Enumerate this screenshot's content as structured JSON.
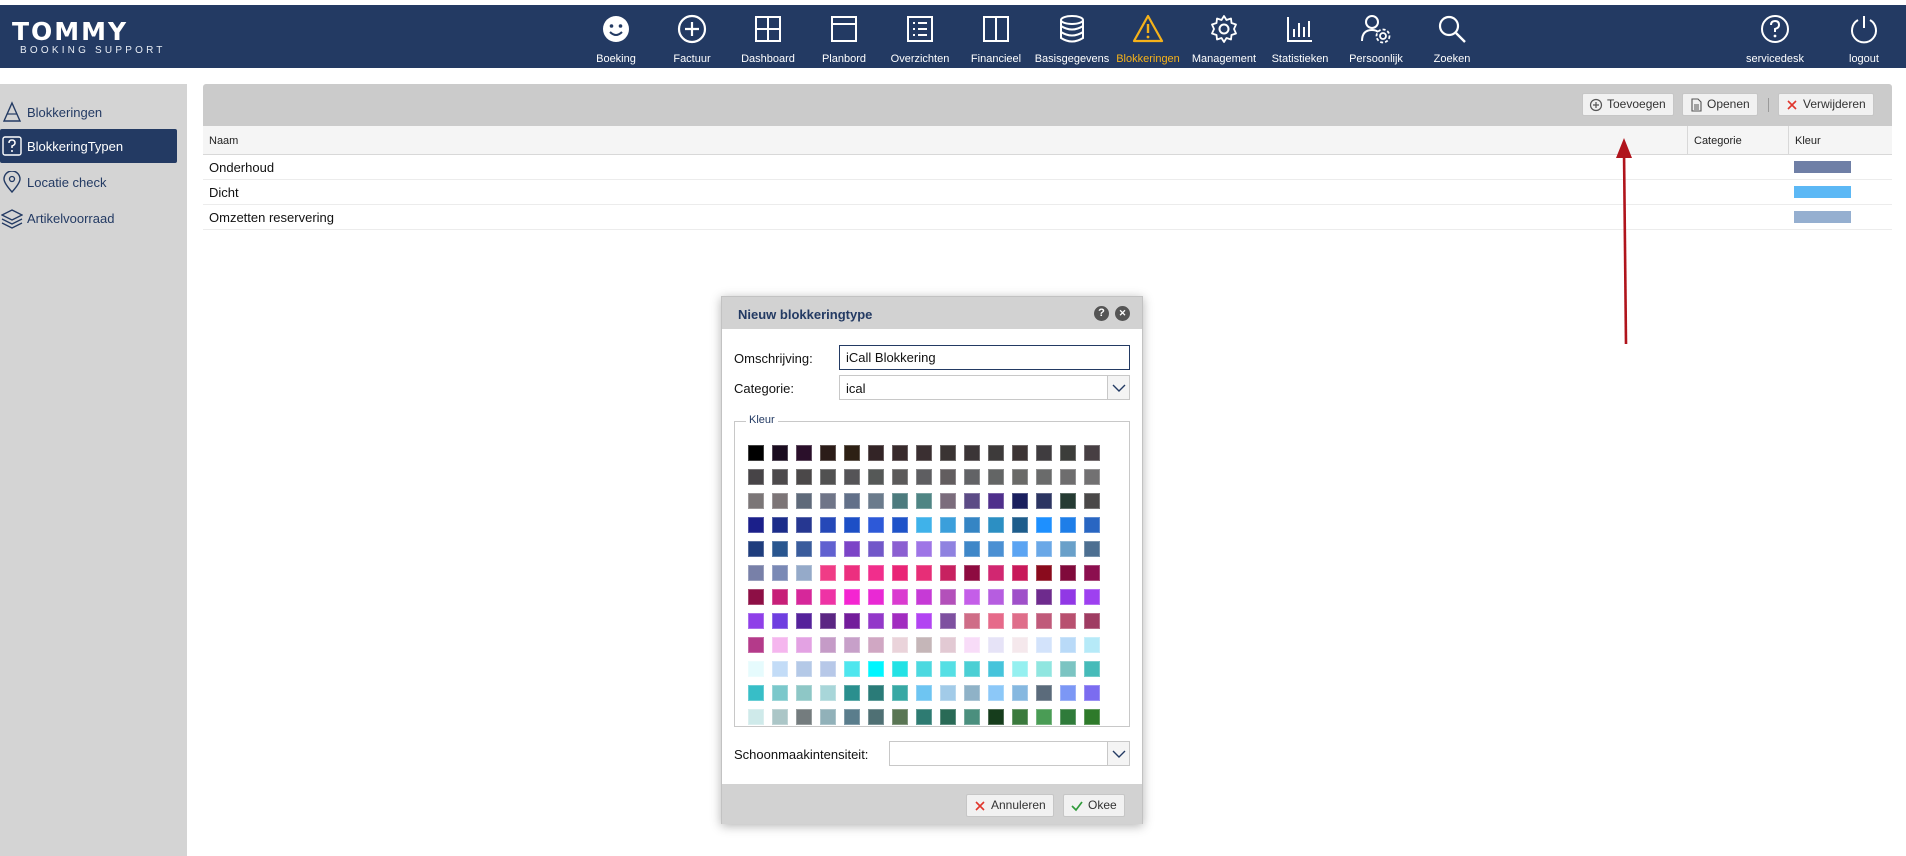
{
  "app": {
    "logo_text": "TOMMY",
    "logo_subtext": "BOOKING SUPPORT",
    "accent_color": "#f5b21a",
    "brand_color": "#233a63"
  },
  "nav": {
    "items": [
      {
        "label": "Boeking",
        "icon": "smiley-icon"
      },
      {
        "label": "Factuur",
        "icon": "plus-circle-icon"
      },
      {
        "label": "Dashboard",
        "icon": "grid-icon"
      },
      {
        "label": "Planbord",
        "icon": "window-icon"
      },
      {
        "label": "Overzichten",
        "icon": "list-icon"
      },
      {
        "label": "Financieel",
        "icon": "book-icon"
      },
      {
        "label": "Basisgegevens",
        "icon": "database-icon"
      },
      {
        "label": "Blokkeringen",
        "icon": "warning-icon",
        "active": true
      },
      {
        "label": "Management",
        "icon": "gear-icon"
      },
      {
        "label": "Statistieken",
        "icon": "bar-chart-icon"
      },
      {
        "label": "Persoonlijk",
        "icon": "user-settings-icon"
      },
      {
        "label": "Zoeken",
        "icon": "search-icon"
      }
    ],
    "right_items": [
      {
        "label": "servicedesk",
        "icon": "help-circle-icon"
      },
      {
        "label": "logout",
        "icon": "power-icon"
      }
    ]
  },
  "sidebar": {
    "items": [
      {
        "label": "Blokkeringen",
        "icon": "cone-icon"
      },
      {
        "label": "BlokkeringTypen",
        "icon": "question-box-icon",
        "selected": true
      },
      {
        "label": "Locatie check",
        "icon": "map-pin-icon"
      },
      {
        "label": "Artikelvoorraad",
        "icon": "layers-icon"
      }
    ]
  },
  "toolbar": {
    "add_label": "Toevoegen",
    "open_label": "Openen",
    "delete_label": "Verwijderen"
  },
  "grid": {
    "columns": [
      "Naam",
      "Categorie",
      "Kleur"
    ],
    "rows": [
      {
        "naam": "Onderhoud",
        "categorie": "",
        "kleur": "#6f7fa6"
      },
      {
        "naam": "Dicht",
        "categorie": "",
        "kleur": "#5cb8f5"
      },
      {
        "naam": "Omzetten reservering",
        "categorie": "",
        "kleur": "#95afd0"
      }
    ]
  },
  "modal": {
    "title": "Nieuw blokkeringtype",
    "help_label": "?",
    "close_label": "✕",
    "omschrijving_label": "Omschrijving:",
    "omschrijving_value": "iCall Blokkering",
    "categorie_label": "Categorie:",
    "categorie_value": "ical",
    "kleur_legend": "Kleur",
    "schoonmaak_label": "Schoonmaakintensiteit:",
    "schoonmaak_value": "",
    "cancel_label": "Annuleren",
    "ok_label": "Okee",
    "palette": [
      [
        "#000000",
        "#1a0c1f",
        "#2a0f2a",
        "#2b1c18",
        "#2d2014",
        "#332426",
        "#382a2c",
        "#3a2f31",
        "#3a3433",
        "#3b3537",
        "#3d3a3a",
        "#3d3535",
        "#3f3c3f",
        "#3c3d3a",
        "#473f43"
      ],
      [
        "#474447",
        "#4d4a4c",
        "#4b4849",
        "#515151",
        "#555457",
        "#555857",
        "#5c5a5a",
        "#5e5e61",
        "#625d5f",
        "#626366",
        "#636565",
        "#6a6a68",
        "#6a6b6b",
        "#6e6d6e",
        "#727172"
      ],
      [
        "#7b7677",
        "#7d7577",
        "#5f6a7a",
        "#6f7588",
        "#627089",
        "#6b7b8c",
        "#4d7b7e",
        "#4f8584",
        "#7b6c7c",
        "#5c4b86",
        "#4f2f8b",
        "#1a1f5e",
        "#2c3562",
        "#253b33",
        "#4a4848"
      ],
      [
        "#1b1f8a",
        "#1b2c8a",
        "#263791",
        "#2548b8",
        "#1d4fc6",
        "#2d59d8",
        "#1f53c9",
        "#3fb2ea",
        "#3b9fdb",
        "#3585c4",
        "#2c8fc3",
        "#1e5d8c",
        "#1e90ff",
        "#1e7ee8",
        "#2966c2"
      ],
      [
        "#1f3d7d",
        "#29568f",
        "#3a5c9c",
        "#6161d0",
        "#7c44c7",
        "#7258c9",
        "#8b5fd1",
        "#9e75e6",
        "#8f82e0",
        "#3f87c8",
        "#4b90d3",
        "#5ba4f2",
        "#6aa8e7",
        "#69a0c9",
        "#4d6f91"
      ],
      [
        "#7880a8",
        "#7a89b5",
        "#95aac9",
        "#f03c86",
        "#ec2f7f",
        "#f12e8c",
        "#e92576",
        "#e72e77",
        "#c72160",
        "#8e0b40",
        "#d12771",
        "#c8195a",
        "#8a0b1d",
        "#800a3b",
        "#8c0f4f"
      ],
      [
        "#8d0f45",
        "#c71f78",
        "#d6279a",
        "#ee33a5",
        "#f425d1",
        "#e929d4",
        "#da3bd0",
        "#c63ad6",
        "#b350ba",
        "#c45ee8",
        "#b65de0",
        "#9f50c9",
        "#6e2b8d",
        "#9138e5",
        "#9e40f0"
      ],
      [
        "#8f3fe8",
        "#6f3ee0",
        "#55229b",
        "#5b2683",
        "#731c9b",
        "#9338c9",
        "#a22dc0",
        "#b244f2",
        "#7e50a0",
        "#cf6d87",
        "#e66a8a",
        "#df6e8a",
        "#c05a7a",
        "#b8506f",
        "#9f3c62"
      ],
      [
        "#b43a8a",
        "#f5b6ee",
        "#e3a2e3",
        "#c59bc7",
        "#c7a0c9",
        "#d0a7c3",
        "#ead3da",
        "#c5b6b8",
        "#e2c9d3",
        "#f8dcf8",
        "#e6e3f7",
        "#f5e8ec",
        "#d3e3fb",
        "#b9daf8",
        "#b6eaf8"
      ],
      [
        "#e6fbfd",
        "#c3dcf7",
        "#b4c9e7",
        "#b7c8e8",
        "#4ee6ee",
        "#00f6ff",
        "#23e2e5",
        "#4cd9e0",
        "#55dfe4",
        "#4bcfd4",
        "#46c4db",
        "#95f0f0",
        "#90e6e0",
        "#7bc4c2",
        "#46bbb9"
      ],
      [
        "#37bec7",
        "#7bc8cb",
        "#8ec7c6",
        "#a8d6d9",
        "#2a8f8e",
        "#2a7b78",
        "#38a8a4",
        "#6ec5f2",
        "#a2cbe8",
        "#8fb2c7",
        "#8cc8f8",
        "#86b8e0",
        "#5b6b7b",
        "#7c97f5",
        "#7b6cf0"
      ],
      [
        "#cfeaea",
        "#abc6c7",
        "#747c7e",
        "#91b1b9",
        "#5a7d8c",
        "#4f7074",
        "#5a7654",
        "#2e7b72",
        "#296a56",
        "#4b8f7e",
        "#163d1c",
        "#3b7a3d",
        "#4a9c55",
        "#2f7b3a",
        "#2e7a2a"
      ]
    ]
  }
}
